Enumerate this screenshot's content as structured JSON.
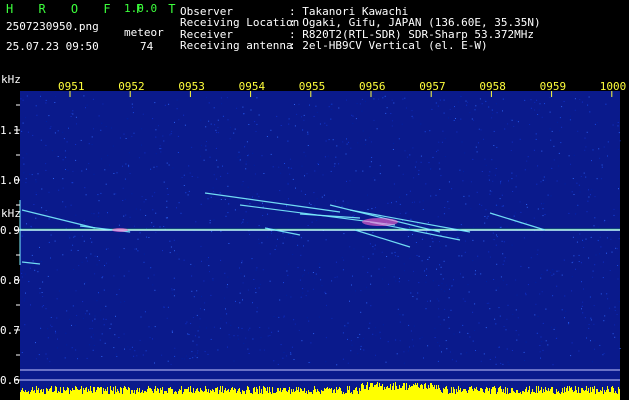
{
  "header": {
    "app_name": "H R O F F T",
    "version": "1.0.0",
    "filename": "2507230950.png",
    "datetime": "25.07.23 09:50",
    "meteor_label": "meteor",
    "meteor_count": "74"
  },
  "info": {
    "observer_label": "Observer",
    "observer_value": ": Takanori Kawachi",
    "location_label": "Receiving Location",
    "location_value": ": Ogaki, Gifu, JAPAN (136.60E, 35.35N)",
    "receiver_label": "Receiver",
    "receiver_value": ": R820T2(RTL-SDR) SDR-Sharp 53.372MHz",
    "antenna_label": "Receiving antenna",
    "antenna_value": ": 2el-HB9CV Vertical (el. E-W)"
  },
  "axes": {
    "unit_top": "kHz",
    "unit_mid": "kHz",
    "time_ticks": [
      "0951",
      "0952",
      "0953",
      "0954",
      "0955",
      "0956",
      "0957",
      "0958",
      "0959",
      "1000"
    ],
    "freq_ticks": [
      "1.1",
      "1.0",
      "0.9",
      "0.8",
      "0.7",
      "0.6"
    ]
  },
  "colors": {
    "background": "#000000",
    "plot_bg": "#0a1a8c",
    "text_green": "#3cff3c",
    "text_white": "#ffffff",
    "tick_yellow": "#ffff3c",
    "carrier": "#c8ffff",
    "meteor": "#7cf0ff",
    "histogram": "#ffff00"
  }
}
